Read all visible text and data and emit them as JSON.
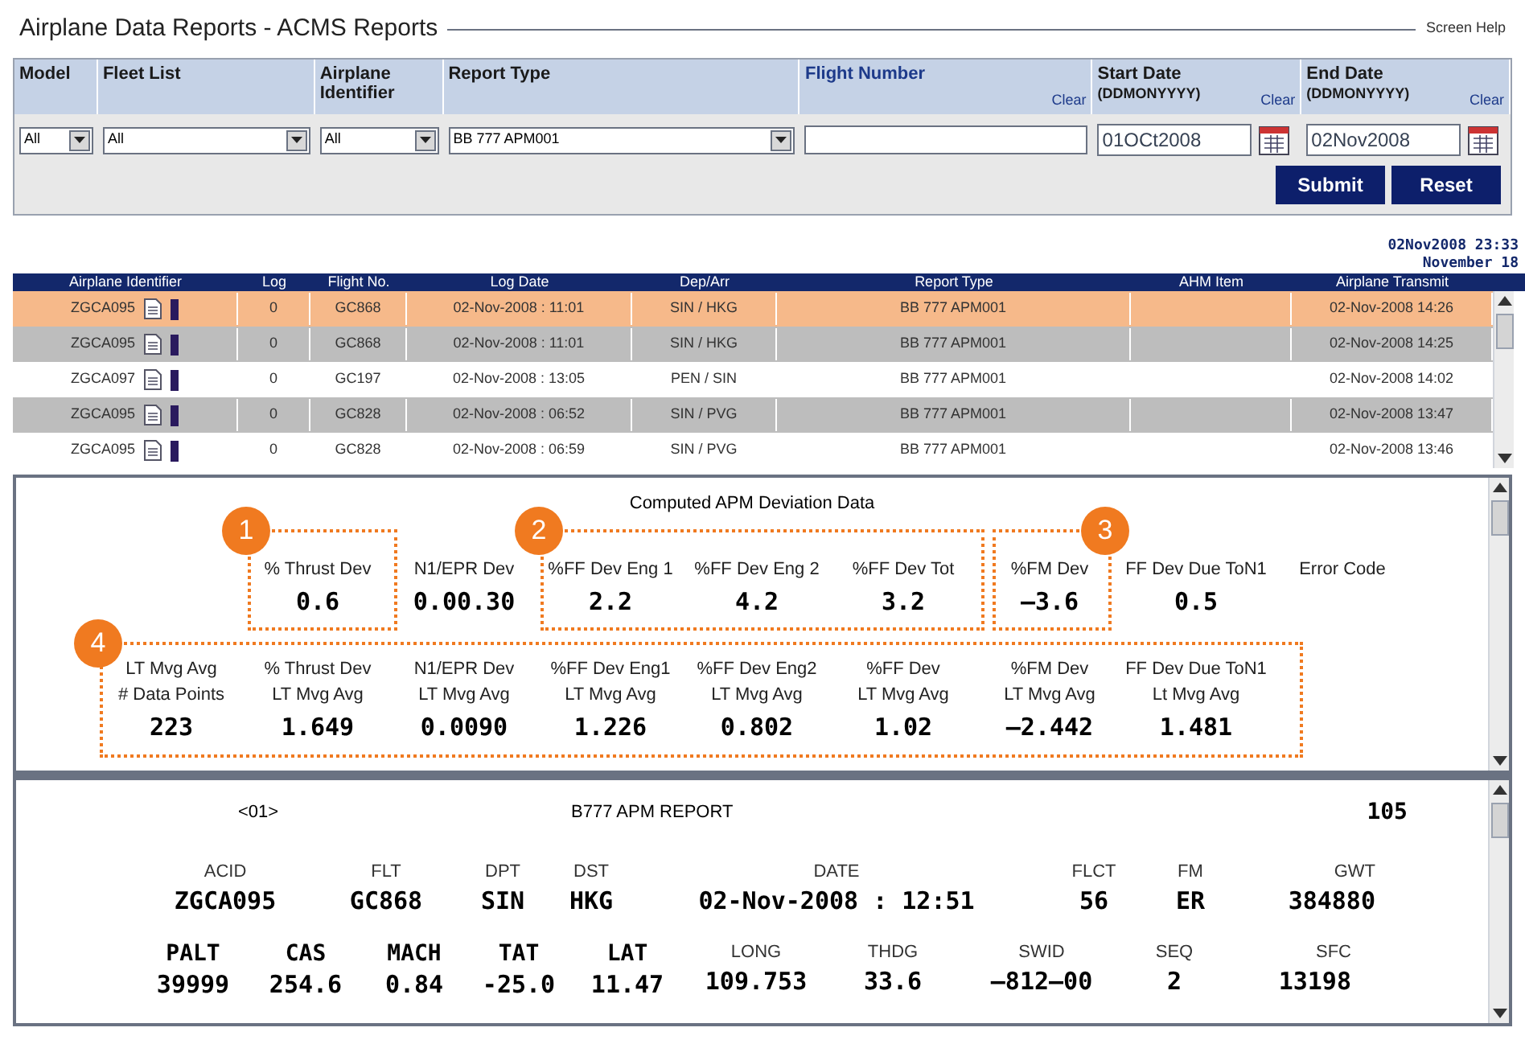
{
  "window": {
    "title": "Airplane Data Reports - ACMS Reports",
    "help_link": "Screen Help"
  },
  "filters": {
    "columns": [
      {
        "label": "Model",
        "kind": "select",
        "value": "All"
      },
      {
        "label": "Fleet List",
        "kind": "select",
        "value": "All"
      },
      {
        "label": "Airplane Identifier",
        "kind": "select",
        "value": "All"
      },
      {
        "label": "Report Type",
        "kind": "select",
        "value": "BB 777 APM001"
      },
      {
        "label": "Flight Number",
        "kind": "text",
        "clear": "Clear"
      },
      {
        "label": "Start Date",
        "hint": "(DDMONYYYY)",
        "kind": "date",
        "value": "01OCt2008",
        "clear": "Clear"
      },
      {
        "label": "End Date",
        "hint": "(DDMONYYYY)",
        "kind": "date",
        "value": "02Nov2008",
        "clear": "Clear"
      }
    ],
    "buttons": [
      "Submit",
      "Reset"
    ]
  },
  "timestamp": [
    "02Nov2008 23:33",
    "November 18"
  ],
  "table": {
    "columns": [
      "Airplane Identifier",
      "Log",
      "Flight No.",
      "Log Date",
      "Dep/Arr",
      "Report Type",
      "AHM Item",
      "Airplane Transmit"
    ],
    "rows": [
      {
        "selected": true,
        "cells": [
          "ZGCA095",
          "0",
          "GC868",
          "02-Nov-2008 : 11:01",
          "SIN / HKG",
          "BB 777 APM001",
          "",
          "02-Nov-2008  14:26"
        ]
      },
      {
        "selected": false,
        "cells": [
          "ZGCA095",
          "0",
          "GC868",
          "02-Nov-2008 : 11:01",
          "SIN / HKG",
          "BB 777 APM001",
          "",
          "02-Nov-2008  14:25"
        ]
      },
      {
        "selected": false,
        "cells": [
          "ZGCA097",
          "0",
          "GC197",
          "02-Nov-2008 : 13:05",
          "PEN / SIN",
          "BB 777 APM001",
          "",
          "02-Nov-2008  14:02"
        ]
      },
      {
        "selected": false,
        "cells": [
          "ZGCA095",
          "0",
          "GC828",
          "02-Nov-2008 : 06:52",
          "SIN / PVG",
          "BB 777 APM001",
          "",
          "02-Nov-2008  13:47"
        ]
      },
      {
        "selected": false,
        "cells": [
          "ZGCA095",
          "0",
          "GC828",
          "02-Nov-2008 : 06:59",
          "SIN / PVG",
          "BB 777 APM001",
          "",
          "02-Nov-2008  13:46"
        ]
      }
    ]
  },
  "deviation": {
    "title": "Computed APM Deviation Data",
    "row_1": [
      {
        "label": [
          "% Thrust Dev"
        ],
        "value": "0.6"
      },
      {
        "label": [
          "N1/EPR Dev"
        ],
        "value": "0.00.30"
      },
      {
        "label": [
          "%FF Dev Eng 1"
        ],
        "value": "2.2"
      },
      {
        "label": [
          "%FF Dev Eng 2"
        ],
        "value": "4.2"
      },
      {
        "label": [
          "%FF Dev Tot"
        ],
        "value": "3.2"
      },
      {
        "label": [
          "%FM Dev"
        ],
        "value": "–3.6"
      },
      {
        "label": [
          "FF Dev Due ToN1"
        ],
        "value": "0.5"
      },
      {
        "label": [
          "Error Code"
        ]
      }
    ],
    "row_2": [
      {
        "label": [
          "LT Mvg Avg",
          "# Data Points"
        ],
        "value": "223"
      },
      {
        "label": [
          "% Thrust Dev",
          "LT Mvg Avg"
        ],
        "value": "1.649"
      },
      {
        "label": [
          "N1/EPR Dev",
          "LT Mvg Avg"
        ],
        "value": "0.0090"
      },
      {
        "label": [
          "%FF Dev Eng1",
          "LT Mvg Avg"
        ],
        "value": "1.226"
      },
      {
        "label": [
          "%FF Dev Eng2",
          "LT Mvg Avg"
        ],
        "value": "0.802"
      },
      {
        "label": [
          "%FF Dev",
          "LT Mvg Avg"
        ],
        "value": "1.02"
      },
      {
        "label": [
          "%FM Dev",
          "LT Mvg Avg"
        ],
        "value": "–2.442"
      },
      {
        "label": [
          "FF Dev Due ToN1",
          "Lt Mvg Avg"
        ],
        "value": "1.481"
      }
    ],
    "callouts": [
      "1",
      "2",
      "3",
      "4"
    ]
  },
  "report": {
    "index": "<01>",
    "title": "B777 APM REPORT",
    "number": "105",
    "row_1": [
      {
        "label": "ACID",
        "value": "ZGCA095",
        "kind": "normal"
      },
      {
        "label": "FLT",
        "value": "GC868",
        "kind": "normal"
      },
      {
        "label": "DPT",
        "value": "SIN",
        "kind": "normal"
      },
      {
        "label": "DST",
        "value": "HKG",
        "kind": "normal"
      },
      {
        "label": "DATE",
        "value": "02-Nov-2008 : 12:51",
        "kind": "normal"
      },
      {
        "label": "FLCT",
        "value": "56",
        "kind": "normal"
      },
      {
        "label": "FM",
        "value": "ER",
        "kind": "normal"
      },
      {
        "label": "GWT",
        "value": "384880",
        "kind": "normal"
      }
    ],
    "row_2": [
      {
        "label": "PALT",
        "value": "39999",
        "kind": "large"
      },
      {
        "label": "CAS",
        "value": "254.6",
        "kind": "large"
      },
      {
        "label": "MACH",
        "value": "0.84",
        "kind": "large"
      },
      {
        "label": "TAT",
        "value": "-25.0",
        "kind": "large"
      },
      {
        "label": "LAT",
        "value": "11.47",
        "kind": "large"
      },
      {
        "label": "LONG",
        "value": "109.753",
        "kind": "normal"
      },
      {
        "label": "THDG",
        "value": "33.6",
        "kind": "normal"
      },
      {
        "label": "SWID",
        "value": "–812–00",
        "kind": "normal"
      },
      {
        "label": "SEQ",
        "value": "2",
        "kind": "normal"
      },
      {
        "label": "SFC",
        "value": "13198",
        "kind": "normal"
      }
    ]
  }
}
